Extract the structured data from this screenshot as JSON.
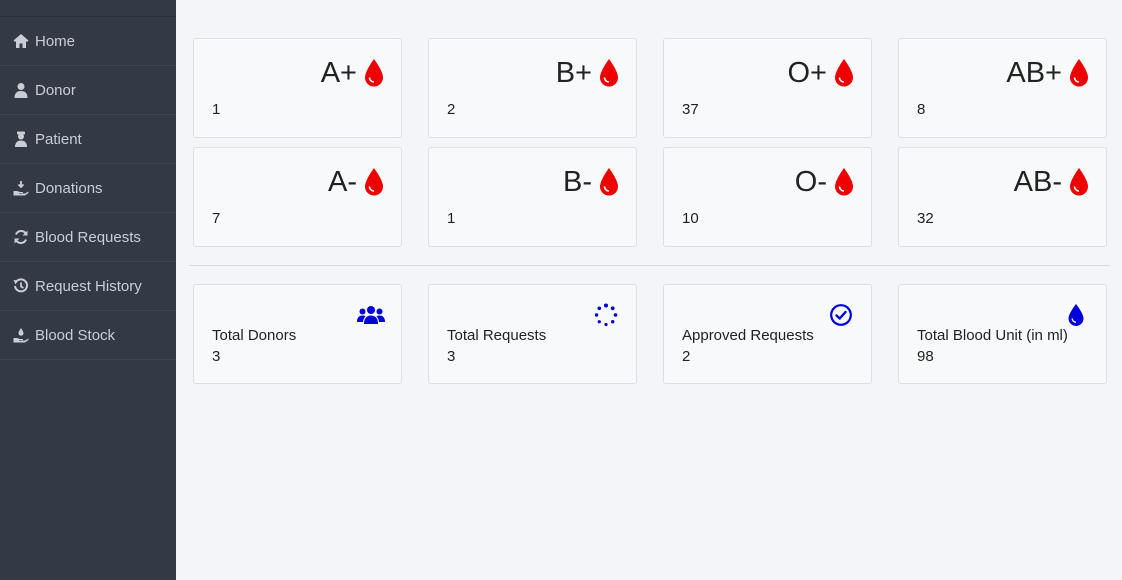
{
  "sidebar": {
    "items": [
      {
        "label": "Home",
        "icon": "home-icon"
      },
      {
        "label": "Donor",
        "icon": "user-icon"
      },
      {
        "label": "Patient",
        "icon": "patient-icon"
      },
      {
        "label": "Donations",
        "icon": "hand-donate-icon"
      },
      {
        "label": "Blood Requests",
        "icon": "sync-icon"
      },
      {
        "label": "Request History",
        "icon": "history-icon"
      },
      {
        "label": "Blood Stock",
        "icon": "hand-stock-icon"
      }
    ]
  },
  "blood_groups": [
    {
      "group": "A+",
      "count": "1"
    },
    {
      "group": "B+",
      "count": "2"
    },
    {
      "group": "O+",
      "count": "37"
    },
    {
      "group": "AB+",
      "count": "8"
    },
    {
      "group": "A-",
      "count": "7"
    },
    {
      "group": "B-",
      "count": "1"
    },
    {
      "group": "O-",
      "count": "10"
    },
    {
      "group": "AB-",
      "count": "32"
    }
  ],
  "stats": [
    {
      "label": "Total Donors",
      "value": "3",
      "icon": "users-icon"
    },
    {
      "label": "Total Requests",
      "value": "3",
      "icon": "spinner-icon"
    },
    {
      "label": "Approved Requests",
      "value": "2",
      "icon": "check-circle-icon"
    },
    {
      "label": "Total Blood Unit (in ml)",
      "value": "98",
      "icon": "drop-icon"
    }
  ],
  "colors": {
    "sidebar_bg": "#343a45",
    "blood_drop": "#ee0000",
    "stat_icon": "#0000dd"
  }
}
